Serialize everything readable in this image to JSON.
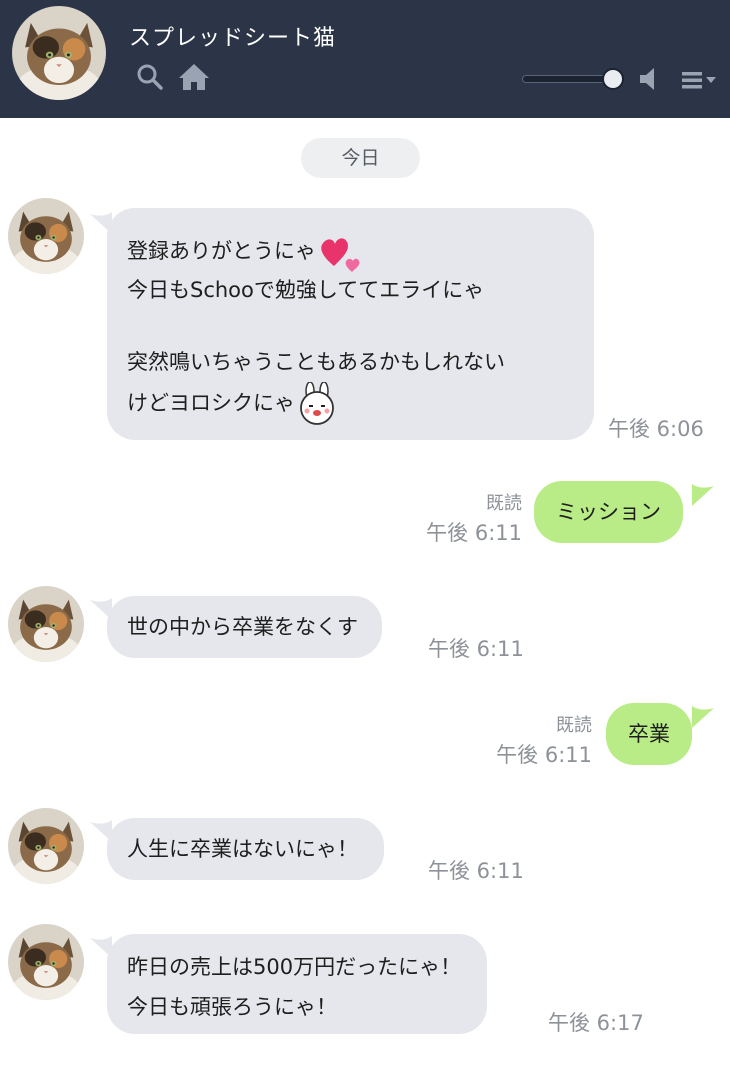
{
  "header": {
    "title": "スプレッドシート猫",
    "volume_level": 0.85
  },
  "date_separator": "今日",
  "messages": [
    {
      "side": "in",
      "lines": [
        "登録ありがとうにゃ",
        "今日もSchooで勉強しててエライにゃ",
        "",
        "突然鳴いちゃうこともあるかもしれない",
        "けどヨロシクにゃ"
      ],
      "time": "午後 6:06",
      "stickers": [
        "heart-emoji",
        "rabbit-face-emoji"
      ]
    },
    {
      "side": "out",
      "text": "ミッション",
      "read": "既読",
      "time": "午後 6:11"
    },
    {
      "side": "in",
      "lines": [
        "世の中から卒業をなくす"
      ],
      "time": "午後 6:11"
    },
    {
      "side": "out",
      "text": "卒業",
      "read": "既読",
      "time": "午後 6:11"
    },
    {
      "side": "in",
      "lines": [
        "人生に卒業はないにゃ！"
      ],
      "time": "午後 6:11"
    },
    {
      "side": "in",
      "lines": [
        "昨日の売上は500万円だったにゃ！",
        "今日も頑張ろうにゃ！"
      ],
      "time": "午後 6:17"
    }
  ],
  "colors": {
    "header_bg": "#2c3547",
    "incoming_bubble": "#e5e7ec",
    "outgoing_bubble": "#b9ec86",
    "meta_text": "#8d9299"
  }
}
